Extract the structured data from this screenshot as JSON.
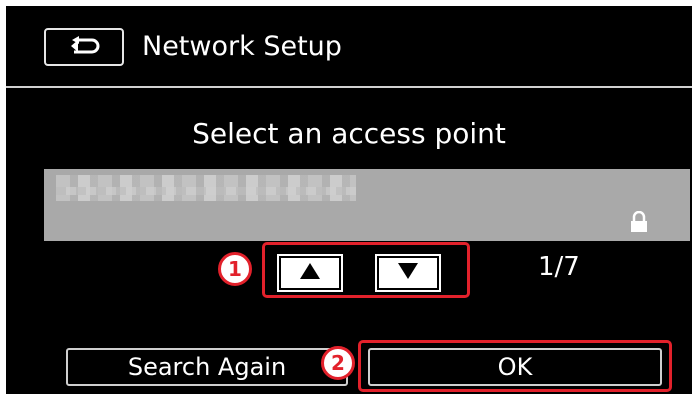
{
  "header": {
    "back_icon": "return-arrow-icon",
    "title": "Network Setup"
  },
  "prompt": "Select an access point",
  "access_point": {
    "name_visible": false,
    "secured_icon": "lock-icon"
  },
  "navigation": {
    "up_icon": "triangle-up-icon",
    "down_icon": "triangle-down-icon",
    "page_indicator": "1/7"
  },
  "callouts": [
    "1",
    "2"
  ],
  "buttons": {
    "search_again": "Search Again",
    "ok": "OK"
  },
  "colors": {
    "background": "#000000",
    "highlight": "#e2212b",
    "list_row": "#a9a9a9",
    "text": "#ffffff"
  }
}
